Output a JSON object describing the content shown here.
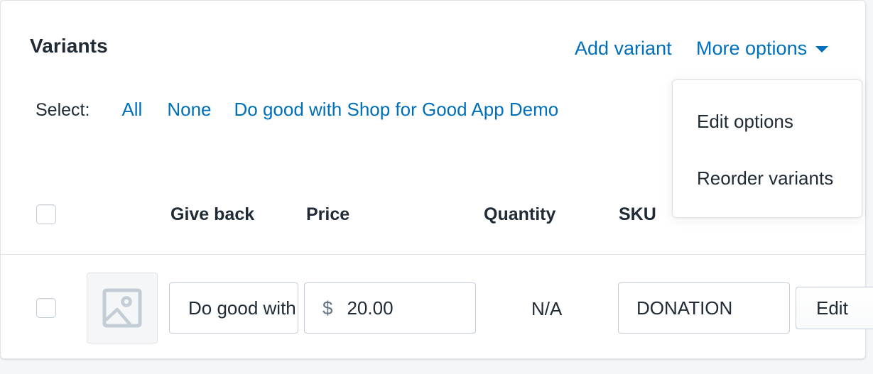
{
  "header": {
    "title": "Variants",
    "add_variant": "Add variant",
    "more_options": "More options"
  },
  "select": {
    "label": "Select:",
    "all": "All",
    "none": "None",
    "option": "Do good with Shop for Good App Demo"
  },
  "table": {
    "columns": [
      "Give back",
      "Price",
      "Quantity",
      "SKU"
    ],
    "rows": [
      {
        "give_back": "Do good with Shop for Good App Demo",
        "currency_symbol": "$",
        "price": "20.00",
        "quantity": "N/A",
        "sku": "DONATION",
        "edit_label": "Edit",
        "thumbnail_icon": "image-placeholder-icon"
      }
    ]
  },
  "more_options_menu": {
    "items": [
      "Edit options",
      "Reorder variants"
    ]
  },
  "colors": {
    "link": "#006fbb",
    "text": "#212b36",
    "border": "#c4cdd5",
    "background": "#f4f6f8"
  }
}
